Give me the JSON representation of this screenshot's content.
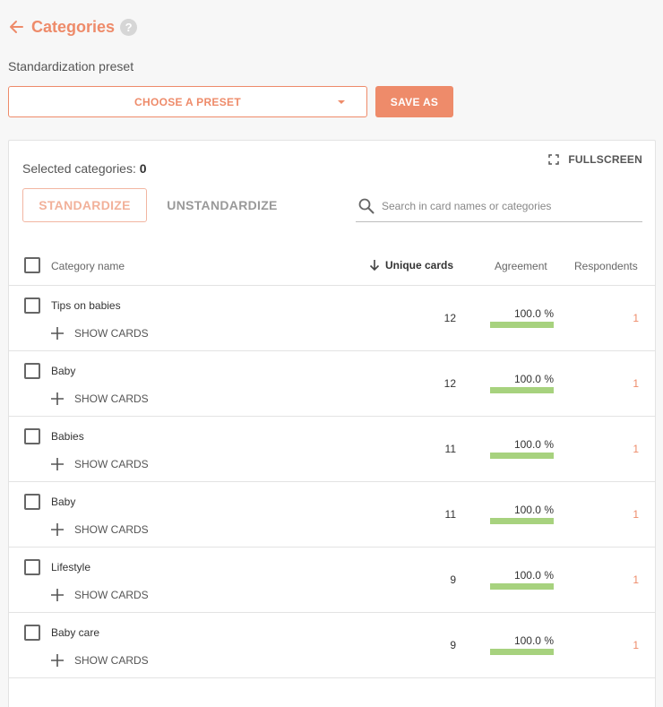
{
  "header": {
    "title": "Categories",
    "help_glyph": "?"
  },
  "preset": {
    "label": "Standardization preset",
    "select_value": "CHOOSE A PRESET",
    "save_label": "SAVE AS"
  },
  "panel": {
    "selected_label": "Selected categories:",
    "selected_count": "0",
    "fullscreen_label": "FULLSCREEN",
    "standardize_label": "STANDARDIZE",
    "unstandardize_label": "UNSTANDARDIZE",
    "search_placeholder": "Search in card names or categories"
  },
  "table": {
    "columns": {
      "name": "Category name",
      "unique": "Unique cards",
      "agreement": "Agreement",
      "respondents": "Respondents"
    },
    "show_cards_label": "SHOW CARDS",
    "rows": [
      {
        "name": "Tips on babies",
        "unique": "12",
        "agreement": "100.0 %",
        "agreement_value": 100,
        "respondents": "1"
      },
      {
        "name": "Baby",
        "unique": "12",
        "agreement": "100.0 %",
        "agreement_value": 100,
        "respondents": "1"
      },
      {
        "name": "Babies",
        "unique": "11",
        "agreement": "100.0 %",
        "agreement_value": 100,
        "respondents": "1"
      },
      {
        "name": "Baby",
        "unique": "11",
        "agreement": "100.0 %",
        "agreement_value": 100,
        "respondents": "1"
      },
      {
        "name": "Lifestyle",
        "unique": "9",
        "agreement": "100.0 %",
        "agreement_value": 100,
        "respondents": "1"
      },
      {
        "name": "Baby care",
        "unique": "9",
        "agreement": "100.0 %",
        "agreement_value": 100,
        "respondents": "1"
      }
    ]
  },
  "colors": {
    "accent": "#ee8b6a",
    "agreement_bar": "#a7d27e"
  },
  "icons": {
    "back": "arrow-left-icon",
    "help": "help-icon",
    "fullscreen": "fullscreen-icon",
    "search": "search-icon",
    "sort": "arrow-down-icon",
    "expand": "plus-icon"
  }
}
